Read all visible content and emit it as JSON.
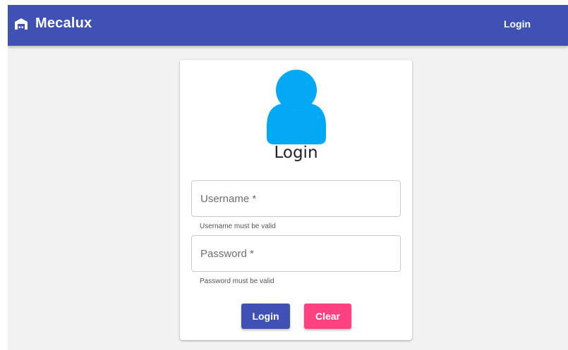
{
  "appbar": {
    "brand_icon": "warehouse-icon",
    "title": "Mecalux",
    "nav_login_label": "Login",
    "color": "#3f51b5"
  },
  "login_card": {
    "avatar_icon": "person-icon",
    "avatar_color": "#03a9f4",
    "title": "Login",
    "username": {
      "placeholder": "Username *",
      "value": "",
      "hint": "Username must be valid"
    },
    "password": {
      "placeholder": "Password *",
      "value": "",
      "hint": "Password must be valid"
    },
    "login_button_label": "Login",
    "clear_button_label": "Clear",
    "login_button_color": "#3f51b5",
    "clear_button_color": "#ff4081"
  }
}
